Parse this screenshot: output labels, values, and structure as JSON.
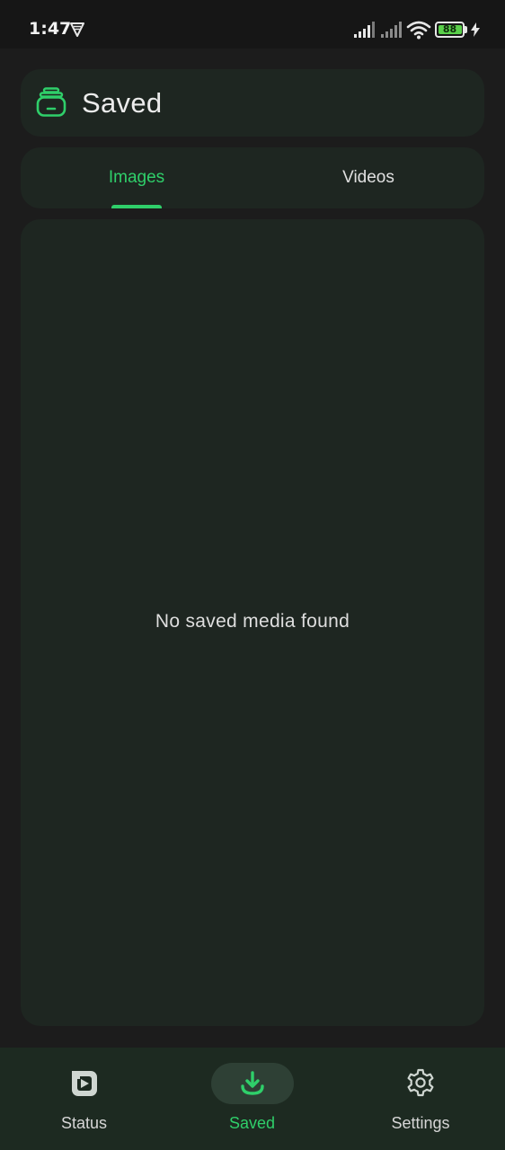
{
  "status_bar": {
    "time": "1:47",
    "battery_level": "88",
    "icons": [
      "vpn-icon",
      "signal-icon",
      "signal-icon",
      "wifi-icon",
      "battery-icon",
      "charging-bolt-icon"
    ]
  },
  "header": {
    "title": "Saved",
    "icon": "saved-stack-icon"
  },
  "tabs": [
    {
      "label": "Images",
      "selected": true
    },
    {
      "label": "Videos",
      "selected": false
    }
  ],
  "content": {
    "empty_message": "No saved media found"
  },
  "bottom_nav": {
    "items": [
      {
        "label": "Status",
        "icon": "status-play-icon",
        "selected": false
      },
      {
        "label": "Saved",
        "icon": "download-icon",
        "selected": true
      },
      {
        "label": "Settings",
        "icon": "gear-icon",
        "selected": false
      }
    ]
  },
  "colors": {
    "accent": "#2fcf6a",
    "background": "#1c1c1c",
    "card": "#1e2621",
    "nav_background": "#1d2a21"
  }
}
